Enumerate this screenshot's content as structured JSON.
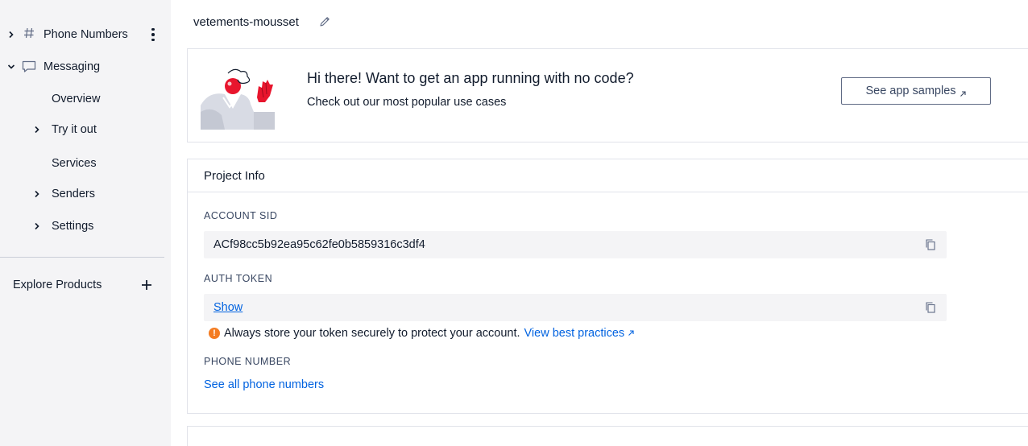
{
  "sidebar": {
    "phone_numbers": "Phone Numbers",
    "messaging": "Messaging",
    "items": [
      {
        "label": "Overview"
      },
      {
        "label": "Try it out"
      },
      {
        "label": "Services"
      },
      {
        "label": "Senders"
      },
      {
        "label": "Settings"
      }
    ],
    "explore_products": "Explore Products"
  },
  "project": {
    "name": "vetements-mousset"
  },
  "banner": {
    "title": "Hi there! Want to get an app running with no code?",
    "subtitle": "Check out our most popular use cases",
    "button_label": "See app samples"
  },
  "project_info": {
    "title": "Project Info",
    "account_sid_label": "ACCOUNT SID",
    "account_sid_value": "ACf98cc5b92ea95c62fe0b5859316c3df4",
    "auth_token_label": "AUTH TOKEN",
    "show_label": "Show",
    "warning_text": "Always store your token securely to protect your account.",
    "best_practices_label": "View best practices",
    "phone_number_label": "PHONE NUMBER",
    "see_all_label": "See all phone numbers"
  },
  "colors": {
    "link": "#0263e0",
    "warning": "#f47c22",
    "sidebar_bg": "#f4f4f6"
  },
  "icons": {
    "hash": "hash-icon",
    "chat": "chat-bubble-icon",
    "kebab": "kebab-menu-icon",
    "plus": "plus-icon",
    "pencil": "pencil-icon",
    "copy": "copy-icon",
    "external": "external-link-icon",
    "warning": "warning-icon"
  }
}
